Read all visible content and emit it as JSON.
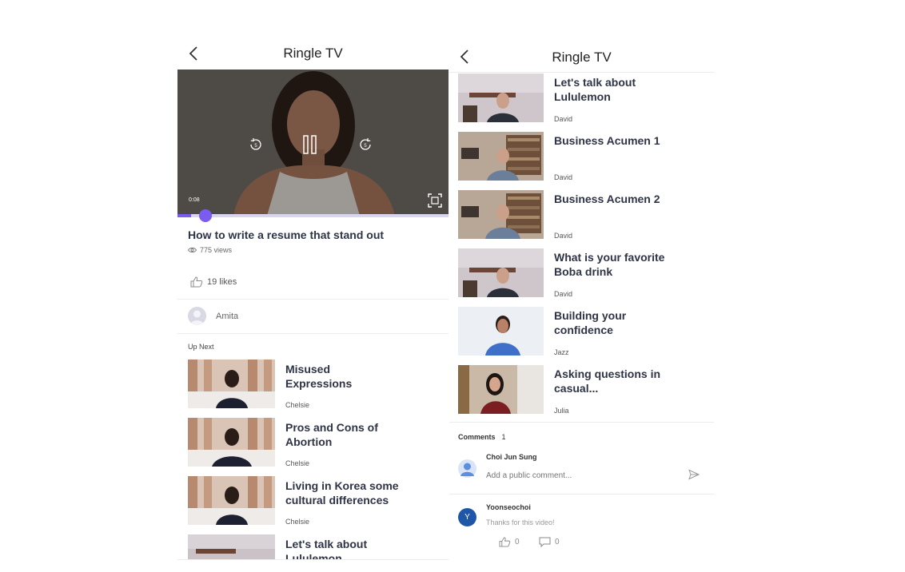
{
  "left_screen": {
    "title": "Ringle TV",
    "video": {
      "timecode": "0:08",
      "progress": 0.05,
      "title": "How to write a resume that stand out",
      "views": "775 views",
      "likes": "19 likes",
      "author": "Amita"
    },
    "upnext_label": "Up Next",
    "up_next": [
      {
        "title_lines": [
          "Misused",
          "Expressions"
        ],
        "author": "Chelsie"
      },
      {
        "title_lines": [
          "Pros and Cons of",
          "Abortion"
        ],
        "author": "Chelsie"
      },
      {
        "title_lines": [
          "Living in Korea some",
          "cultural differences"
        ],
        "author": "Chelsie"
      },
      {
        "title_lines": [
          "Let's talk about",
          "Lululemon"
        ],
        "author": ""
      }
    ]
  },
  "right_screen": {
    "title": "Ringle TV",
    "videos": [
      {
        "title_lines": [
          "Let's talk about",
          "Lululemon"
        ],
        "author": "David"
      },
      {
        "title_lines": [
          "Business Acumen 1",
          ""
        ],
        "author": "David"
      },
      {
        "title_lines": [
          "Business Acumen 2",
          ""
        ],
        "author": "David"
      },
      {
        "title_lines": [
          "What is your favorite",
          "Boba drink"
        ],
        "author": "David"
      },
      {
        "title_lines": [
          "Building your",
          "confidence"
        ],
        "author": "Jazz"
      },
      {
        "title_lines": [
          "Asking questions in",
          "casual..."
        ],
        "author": "Julia"
      }
    ],
    "comments": {
      "label": "Comments",
      "count": "1",
      "current_user": "Choi Jun Sung",
      "input_placeholder": "Add a public comment...",
      "items": [
        {
          "avatar_letter": "Y",
          "user": "Yoonseochoi",
          "text": "Thanks for this video!",
          "likes": "0",
          "replies": "0"
        }
      ]
    }
  },
  "colors": {
    "accent": "#7b5cf0",
    "avatar_blue": "#1f56a8",
    "avatar_light": "#5b8fe0"
  }
}
